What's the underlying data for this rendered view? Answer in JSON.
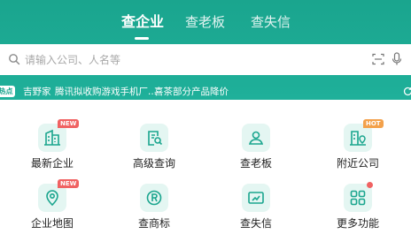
{
  "tabs": [
    {
      "label": "查企业",
      "active": true
    },
    {
      "label": "查老板",
      "active": false
    },
    {
      "label": "查失信",
      "active": false
    }
  ],
  "search": {
    "placeholder": "请输入公司、人名等"
  },
  "ticker": {
    "tag": "热点",
    "items": [
      "吉野家",
      "腾讯拟收购游戏手机厂...",
      "喜茶部分产品降价"
    ]
  },
  "grid": [
    {
      "label": "最新企业",
      "icon": "building-icon",
      "badge": "NEW"
    },
    {
      "label": "高级查询",
      "icon": "search-doc-icon",
      "badge": ""
    },
    {
      "label": "查老板",
      "icon": "person-icon",
      "badge": ""
    },
    {
      "label": "附近公司",
      "icon": "location-building-icon",
      "badge": "HOT"
    },
    {
      "label": "企业地图",
      "icon": "map-pin-icon",
      "badge": "NEW"
    },
    {
      "label": "查商标",
      "icon": "trademark-icon",
      "badge": ""
    },
    {
      "label": "查失信",
      "icon": "dishonesty-icon",
      "badge": ""
    },
    {
      "label": "更多功能",
      "icon": "grid-icon",
      "badge": "dot"
    }
  ],
  "colors": {
    "brand": "#1aa58e",
    "badge_new": "#f06262",
    "badge_hot": "#f3a14b"
  }
}
